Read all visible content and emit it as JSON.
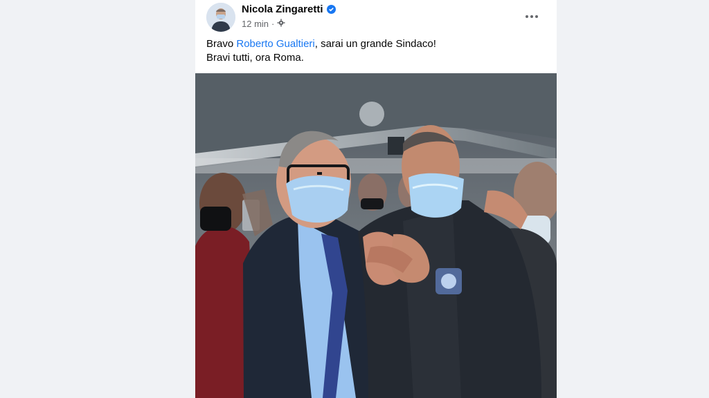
{
  "post": {
    "author": "Nicola Zingaretti",
    "time": "12 min",
    "audience_icon": "gear-icon",
    "verified_icon": "verified-badge-icon",
    "more_icon": "more-options-icon",
    "text_prefix": "Bravo ",
    "mention": "Roberto Gualtieri",
    "text_suffix": ", sarai un grande Sindaco!",
    "text_line2": "Bravi tutti, ora Roma."
  },
  "colors": {
    "page_bg": "#f0f2f5",
    "card_bg": "#ffffff",
    "link": "#1877f2",
    "secondary_text": "#65676b",
    "primary_text": "#050505"
  }
}
